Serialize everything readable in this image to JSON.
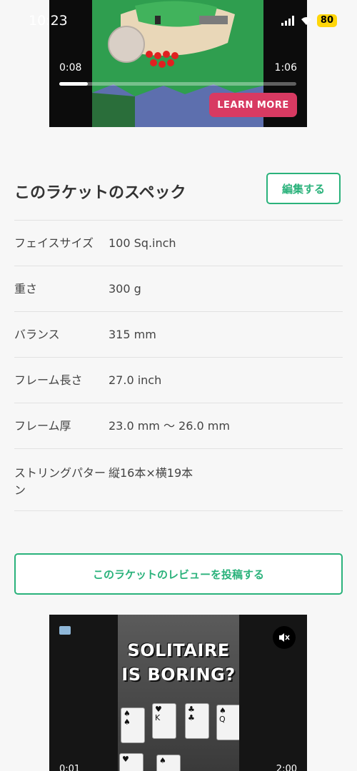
{
  "status_bar": {
    "time": "10:23",
    "battery": "80"
  },
  "top_ad": {
    "elapsed": "0:08",
    "duration": "1:06",
    "progress": 0.12,
    "cta_label": "LEARN MORE",
    "cta_color": "#d83a62"
  },
  "specs": {
    "title": "このラケットのスペック",
    "edit_label": "編集する",
    "rows": [
      {
        "label": "フェイスサイズ",
        "value": "100 Sq.inch"
      },
      {
        "label": "重さ",
        "value": "300 g"
      },
      {
        "label": "バランス",
        "value": "315 mm"
      },
      {
        "label": "フレーム長さ",
        "value": "27.0 inch"
      },
      {
        "label": "フレーム厚",
        "value": "23.0 mm 〜 26.0 mm"
      },
      {
        "label": "ストリングパターン",
        "value": "縦16本×横19本"
      }
    ]
  },
  "review_button_label": "このラケットのレビューを投稿する",
  "accent_color": "#2ab27b",
  "bottom_ad": {
    "headline_line1": "SOLITAIRE",
    "headline_line2": "IS BORING?",
    "elapsed": "0:01",
    "duration": "2:00"
  },
  "icons": [
    "signal-icon",
    "wifi-icon",
    "battery-icon",
    "closed-caption-icon",
    "mute-icon"
  ]
}
